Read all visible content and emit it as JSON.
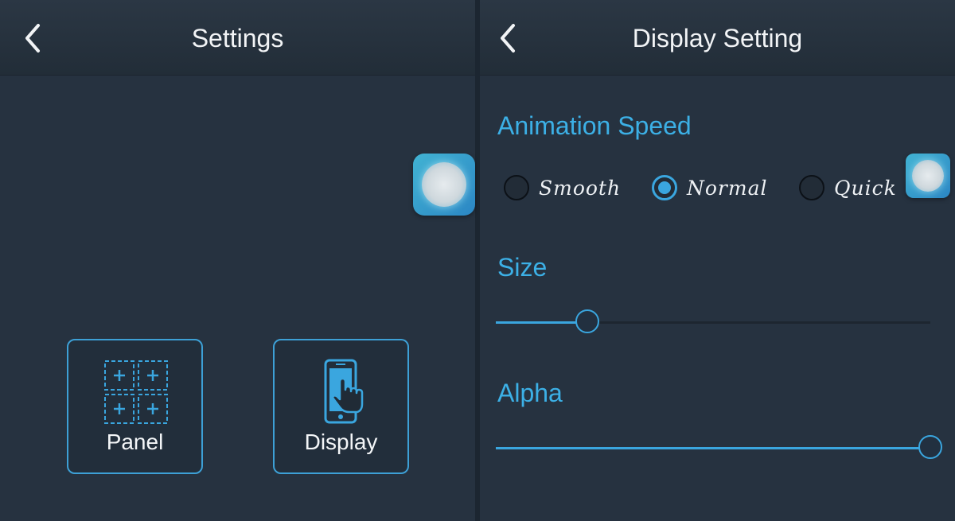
{
  "settings": {
    "title": "Settings",
    "tiles": [
      {
        "label": "Panel",
        "icon": "panel-grid-icon"
      },
      {
        "label": "Display",
        "icon": "phone-touch-icon"
      }
    ]
  },
  "display_setting": {
    "title": "Display Setting",
    "animation_speed": {
      "label": "Animation Speed",
      "options": [
        "Smooth",
        "Normal",
        "Quick"
      ],
      "selected": "Normal"
    },
    "size": {
      "label": "Size",
      "value_fraction": 0.21
    },
    "alpha": {
      "label": "Alpha",
      "value_fraction": 1.0
    }
  },
  "colors": {
    "accent": "#3aa6df",
    "background": "#263240",
    "header": "#222d38"
  }
}
